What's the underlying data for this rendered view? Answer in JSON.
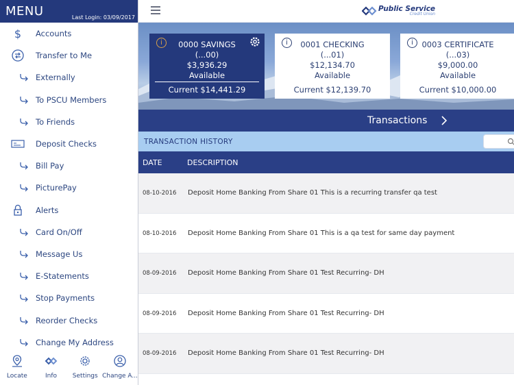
{
  "sidebar": {
    "title": "MENU",
    "last_login": "Last Login: 03/09/2017",
    "items": [
      {
        "label": "Accounts",
        "icon": "dollar-icon",
        "type": "top"
      },
      {
        "label": "Transfer to Me",
        "icon": "transfer-icon",
        "type": "top"
      },
      {
        "label": "Externally",
        "icon": "arrow-icon",
        "type": "sub"
      },
      {
        "label": "To PSCU Members",
        "icon": "arrow-icon",
        "type": "sub"
      },
      {
        "label": "To Friends",
        "icon": "arrow-icon",
        "type": "sub"
      },
      {
        "label": "Deposit Checks",
        "icon": "check-icon",
        "type": "top"
      },
      {
        "label": "Bill Pay",
        "icon": "arrow-icon",
        "type": "sub"
      },
      {
        "label": "PicturePay",
        "icon": "arrow-icon",
        "type": "sub"
      },
      {
        "label": "Alerts",
        "icon": "lock-icon",
        "type": "top"
      },
      {
        "label": "Card On/Off",
        "icon": "arrow-icon",
        "type": "sub"
      },
      {
        "label": "Message Us",
        "icon": "arrow-icon",
        "type": "sub"
      },
      {
        "label": "E-Statements",
        "icon": "arrow-icon",
        "type": "sub"
      },
      {
        "label": "Stop Payments",
        "icon": "arrow-icon",
        "type": "sub"
      },
      {
        "label": "Reorder Checks",
        "icon": "arrow-icon",
        "type": "sub"
      },
      {
        "label": "Change My Address",
        "icon": "arrow-icon",
        "type": "sub"
      }
    ],
    "footer": [
      {
        "label": "Locate",
        "icon": "map-pin-icon"
      },
      {
        "label": "Info",
        "icon": "logo-icon"
      },
      {
        "label": "Settings",
        "icon": "gear-icon"
      },
      {
        "label": "Change A...",
        "icon": "user-icon"
      }
    ]
  },
  "header": {
    "brand": "Public Service",
    "brand_sub": "Credit Union"
  },
  "accounts": [
    {
      "name": "0000 SAVINGS",
      "number": "(...00)",
      "balance": "$3,936.29",
      "available": "Available",
      "current": "Current $14,441.29",
      "active": true
    },
    {
      "name": "0001 CHECKING",
      "number": "(...01)",
      "balance": "$12,134.70",
      "available": "Available",
      "current": "Current $12,139.70",
      "active": false
    },
    {
      "name": "0003 CERTIFICATE",
      "number": "(...03)",
      "balance": "$9,000.00",
      "available": "Available",
      "current": "Current $10,000.00",
      "active": false
    }
  ],
  "transactions_label": "Transactions",
  "history_label": "TRANSACTION HISTORY",
  "columns": {
    "date": "DATE",
    "description": "DESCRIPTION"
  },
  "rows": [
    {
      "date": "08-10-2016",
      "description": "Deposit Home Banking From Share 01 This is a recurring transfer qa test"
    },
    {
      "date": "08-10-2016",
      "description": "Deposit Home Banking From Share 01 This is a qa test for same day payment"
    },
    {
      "date": "08-09-2016",
      "description": "Deposit Home Banking From Share 01 Test Recurring- DH"
    },
    {
      "date": "08-09-2016",
      "description": "Deposit Home Banking From Share 01 Test Recurring- DH"
    },
    {
      "date": "08-09-2016",
      "description": "Deposit Home Banking From Share 01 Test Recurring- DH"
    }
  ],
  "colors": {
    "primary": "#24397c",
    "history_bar": "#a8cdf1",
    "info_active": "#d9a24a"
  }
}
